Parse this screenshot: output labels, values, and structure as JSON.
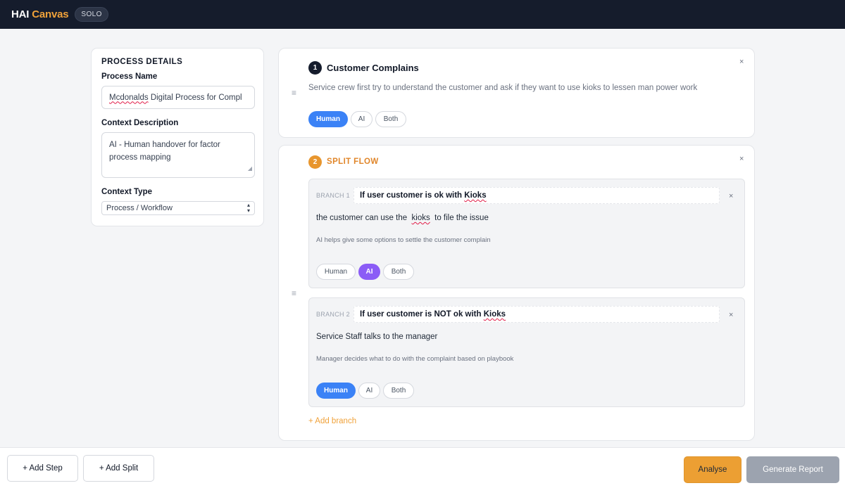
{
  "header": {
    "brand_main": "HAI",
    "brand_accent": "Canvas",
    "mode_badge": "SOLO"
  },
  "details": {
    "title": "PROCESS DETAILS",
    "process_name_label": "Process Name",
    "process_name_value": "Mcdonalds Digital Process for Compl",
    "context_desc_label": "Context Description",
    "context_desc_value": "AI - Human handover for factor process mapping",
    "context_type_label": "Context Type",
    "context_type_value": "Process / Workflow"
  },
  "steps": [
    {
      "number": "1",
      "title": "Customer Complains",
      "description": "Service crew first try to understand the customer and ask if they want to use kioks to lessen man power work",
      "owner_options": [
        "Human",
        "AI",
        "Both"
      ],
      "owner_selected": "Human"
    },
    {
      "number": "2",
      "title": "SPLIT FLOW",
      "branches": [
        {
          "label": "BRANCH 1",
          "condition_prefix": "If user customer is ok with ",
          "condition_word": "Kioks",
          "main_prefix": "the customer can use the ",
          "main_word": "kioks",
          "main_suffix": " to file the issue",
          "note": "AI helps give some options to settle the customer complain",
          "owner_options": [
            "Human",
            "AI",
            "Both"
          ],
          "owner_selected": "AI"
        },
        {
          "label": "BRANCH 2",
          "condition_prefix": "If user customer is NOT ok with ",
          "condition_word": "Kioks",
          "main": "Service Staff talks to the manager",
          "note": "Manager decides what to do with the complaint based on playbook",
          "owner_options": [
            "Human",
            "AI",
            "Both"
          ],
          "owner_selected": "Human"
        }
      ],
      "add_branch_label": "+ Add branch"
    }
  ],
  "footer": {
    "add_step": "+ Add Step",
    "add_split": "+ Add Split",
    "analyse": "Analyse",
    "generate_report": "Generate Report"
  },
  "icons": {
    "close": "close-icon",
    "drag": "drag-handle-icon",
    "select_chevron": "chevron-updown-icon"
  },
  "colors": {
    "topbar": "#151c2c",
    "brand_accent": "#f0a23a",
    "human_selected": "#3b82f6",
    "ai_selected": "#8b5cf6",
    "split_accent": "#e8962e",
    "analyse_button": "#ec9f33",
    "report_button_disabled": "#9ca3af"
  }
}
